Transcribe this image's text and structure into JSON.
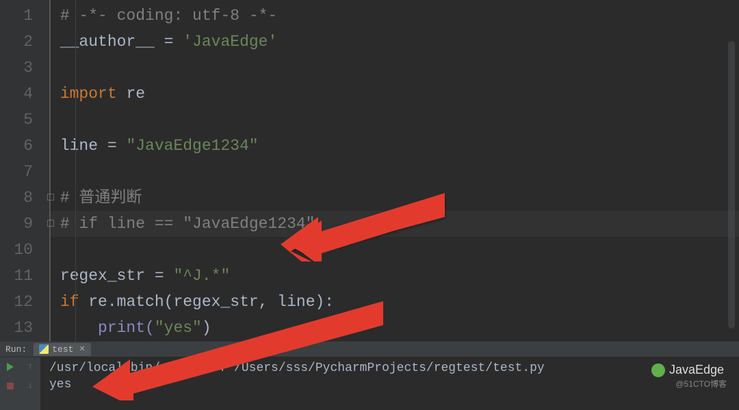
{
  "gutter": {
    "lines": [
      "1",
      "2",
      "3",
      "4",
      "5",
      "6",
      "7",
      "8",
      "9",
      "10",
      "11",
      "12",
      "13"
    ]
  },
  "code": {
    "l1_comment": "# -*- coding: utf-8 -*-",
    "l2_a": "__author__",
    "l2_b": " = ",
    "l2_c": "'JavaEdge'",
    "l4_a": "import ",
    "l4_b": "re",
    "l6_a": "line = ",
    "l6_b": "\"JavaEdge1234\"",
    "l8_comment": "# 普通判断",
    "l9_comment": "# if line == \"JavaEdge1234\"",
    "l11_a": "regex_str = ",
    "l11_b": "\"^J.*\"",
    "l12_a": "if ",
    "l12_b": "re.match(regex_str",
    "l12_c": ", ",
    "l12_d": "line):",
    "l13_a": "print(",
    "l13_b": "\"yes\"",
    "l13_c": ")"
  },
  "run": {
    "panel_label": "Run:",
    "tab_name": "test",
    "console_line1": "/usr/local/bin/python3.7 /Users/sss/PycharmProjects/regtest/test.py",
    "console_line2": "yes"
  },
  "watermark": {
    "brand": "JavaEdge",
    "source": "@51CTO博客"
  }
}
